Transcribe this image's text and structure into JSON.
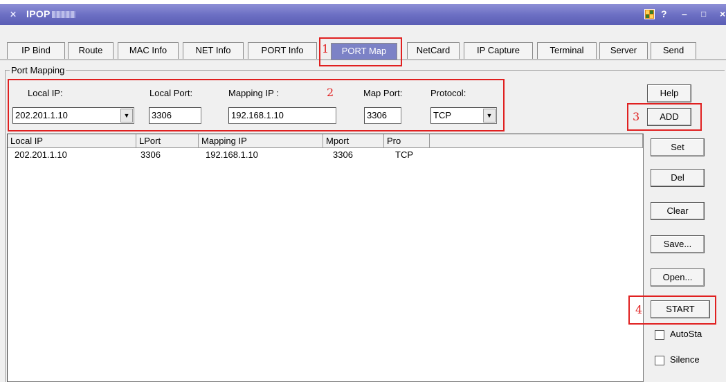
{
  "window": {
    "title": "IPOP",
    "sys_icon": "chevron-icon",
    "controls": {
      "help": "?",
      "minimize": "–",
      "maximize": "□",
      "close": "×"
    }
  },
  "tabs": [
    {
      "label": "IP Bind"
    },
    {
      "label": "Route"
    },
    {
      "label": "MAC Info"
    },
    {
      "label": "NET Info"
    },
    {
      "label": "PORT Info"
    },
    {
      "label": "PORT Map"
    },
    {
      "label": "NetCard"
    },
    {
      "label": "IP Capture"
    },
    {
      "label": "Terminal"
    },
    {
      "label": "Server"
    },
    {
      "label": "Send"
    }
  ],
  "group": {
    "title": "Port Mapping",
    "local_ip_label": "Local IP:",
    "local_ip_value": "202.201.1.10",
    "local_port_label": "Local Port:",
    "local_port_value": "3306",
    "mapping_ip_label": "Mapping IP :",
    "mapping_ip_value": "192.168.1.10",
    "map_port_label": "Map Port:",
    "map_port_value": "3306",
    "protocol_label": "Protocol:",
    "protocol_value": "TCP"
  },
  "list": {
    "columns": [
      "Local IP",
      "LPort",
      "Mapping IP",
      "Mport",
      "Pro"
    ],
    "rows": [
      [
        "202.201.1.10",
        "3306",
        "192.168.1.10",
        "3306",
        "TCP"
      ]
    ]
  },
  "buttons": {
    "help": "Help",
    "add": "ADD",
    "set": "Set",
    "del": "Del",
    "clear": "Clear",
    "save": "Save...",
    "open": "Open...",
    "start": "START"
  },
  "checkboxes": {
    "autostart": "AutoSta",
    "silence": "Silence"
  },
  "annotations": [
    "1",
    "2",
    "3",
    "4"
  ],
  "colors": {
    "annotation": "#e02020",
    "titlebar": "#6d70c4",
    "active_tab": "#7c82c6"
  }
}
